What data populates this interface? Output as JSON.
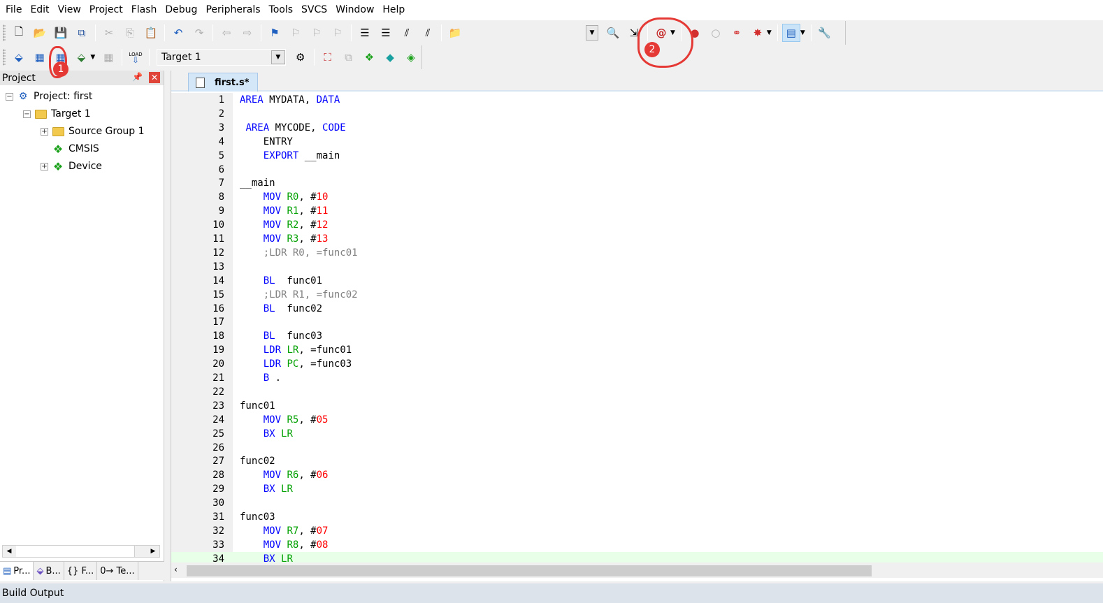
{
  "menu": [
    "File",
    "Edit",
    "View",
    "Project",
    "Flash",
    "Debug",
    "Peripherals",
    "Tools",
    "SVCS",
    "Window",
    "Help"
  ],
  "toolbar2": {
    "target_value": "Target 1",
    "load_label": "LOAD"
  },
  "annotations": {
    "one": "1",
    "two": "2"
  },
  "project_panel": {
    "title": "Project",
    "tree": [
      {
        "label": "Project: first"
      },
      {
        "label": "Target 1"
      },
      {
        "label": "Source Group 1"
      },
      {
        "label": "CMSIS"
      },
      {
        "label": "Device"
      }
    ]
  },
  "panel_tabs": [
    "Pr...",
    "B...",
    "{} F...",
    "0→ Te..."
  ],
  "editor": {
    "tab_label": "first.s*",
    "lines": [
      [
        [
          "t",
          "AREA MYDATA, DATA",
          "kw2"
        ]
      ],
      [],
      [
        [
          "t",
          " "
        ],
        [
          "k",
          "AREA"
        ],
        [
          "t",
          " MYCODE, "
        ],
        [
          "k",
          "CODE"
        ]
      ],
      [
        [
          "t",
          "    "
        ],
        [
          "p",
          "ENTRY"
        ]
      ],
      [
        [
          "t",
          "    "
        ],
        [
          "k",
          "EXPORT"
        ],
        [
          "t",
          " __main"
        ]
      ],
      [],
      [
        [
          "t",
          "__main"
        ]
      ],
      [
        [
          "t",
          "    "
        ],
        [
          "k",
          "MOV"
        ],
        [
          "t",
          " "
        ],
        [
          "r",
          "R0"
        ],
        [
          "t",
          ", #"
        ],
        [
          "n",
          "10"
        ]
      ],
      [
        [
          "t",
          "    "
        ],
        [
          "k",
          "MOV"
        ],
        [
          "t",
          " "
        ],
        [
          "r",
          "R1"
        ],
        [
          "t",
          ", #"
        ],
        [
          "n",
          "11"
        ]
      ],
      [
        [
          "t",
          "    "
        ],
        [
          "k",
          "MOV"
        ],
        [
          "t",
          " "
        ],
        [
          "r",
          "R2"
        ],
        [
          "t",
          ", #"
        ],
        [
          "n",
          "12"
        ]
      ],
      [
        [
          "t",
          "    "
        ],
        [
          "k",
          "MOV"
        ],
        [
          "t",
          " "
        ],
        [
          "r",
          "R3"
        ],
        [
          "t",
          ", #"
        ],
        [
          "n",
          "13"
        ]
      ],
      [
        [
          "t",
          "    "
        ],
        [
          "c",
          ";LDR R0, =func01"
        ]
      ],
      [],
      [
        [
          "t",
          "    "
        ],
        [
          "k",
          "BL"
        ],
        [
          "t",
          "  func01"
        ]
      ],
      [
        [
          "t",
          "    "
        ],
        [
          "c",
          ";LDR R1, =func02"
        ]
      ],
      [
        [
          "t",
          "    "
        ],
        [
          "k",
          "BL"
        ],
        [
          "t",
          "  func02"
        ]
      ],
      [],
      [
        [
          "t",
          "    "
        ],
        [
          "k",
          "BL"
        ],
        [
          "t",
          "  func03"
        ]
      ],
      [
        [
          "t",
          "    "
        ],
        [
          "k",
          "LDR"
        ],
        [
          "t",
          " "
        ],
        [
          "r",
          "LR"
        ],
        [
          "t",
          ", =func01"
        ]
      ],
      [
        [
          "t",
          "    "
        ],
        [
          "k",
          "LDR"
        ],
        [
          "t",
          " "
        ],
        [
          "r",
          "PC"
        ],
        [
          "t",
          ", =func03"
        ]
      ],
      [
        [
          "t",
          "    "
        ],
        [
          "k",
          "B"
        ],
        [
          "t",
          " ."
        ]
      ],
      [],
      [
        [
          "t",
          "func01"
        ]
      ],
      [
        [
          "t",
          "    "
        ],
        [
          "k",
          "MOV"
        ],
        [
          "t",
          " "
        ],
        [
          "r",
          "R5"
        ],
        [
          "t",
          ", #"
        ],
        [
          "n",
          "05"
        ]
      ],
      [
        [
          "t",
          "    "
        ],
        [
          "k",
          "BX"
        ],
        [
          "t",
          " "
        ],
        [
          "r",
          "LR"
        ]
      ],
      [],
      [
        [
          "t",
          "func02"
        ]
      ],
      [
        [
          "t",
          "    "
        ],
        [
          "k",
          "MOV"
        ],
        [
          "t",
          " "
        ],
        [
          "r",
          "R6"
        ],
        [
          "t",
          ", #"
        ],
        [
          "n",
          "06"
        ]
      ],
      [
        [
          "t",
          "    "
        ],
        [
          "k",
          "BX"
        ],
        [
          "t",
          " "
        ],
        [
          "r",
          "LR"
        ]
      ],
      [],
      [
        [
          "t",
          "func03"
        ]
      ],
      [
        [
          "t",
          "    "
        ],
        [
          "k",
          "MOV"
        ],
        [
          "t",
          " "
        ],
        [
          "r",
          "R7"
        ],
        [
          "t",
          ", #"
        ],
        [
          "n",
          "07"
        ]
      ],
      [
        [
          "t",
          "    "
        ],
        [
          "k",
          "MOV"
        ],
        [
          "t",
          " "
        ],
        [
          "r",
          "R8"
        ],
        [
          "t",
          ", #"
        ],
        [
          "n",
          "08"
        ]
      ],
      [
        [
          "t",
          "    "
        ],
        [
          "k",
          "BX"
        ],
        [
          "t",
          " "
        ],
        [
          "r",
          "LR"
        ]
      ]
    ],
    "current_line": 34
  },
  "build_output": {
    "title": "Build Output"
  },
  "colors": {
    "keyword": "#0000ff",
    "register": "#00a000",
    "number": "#ff0000",
    "comment": "#808080",
    "annotation": "#e53935"
  }
}
